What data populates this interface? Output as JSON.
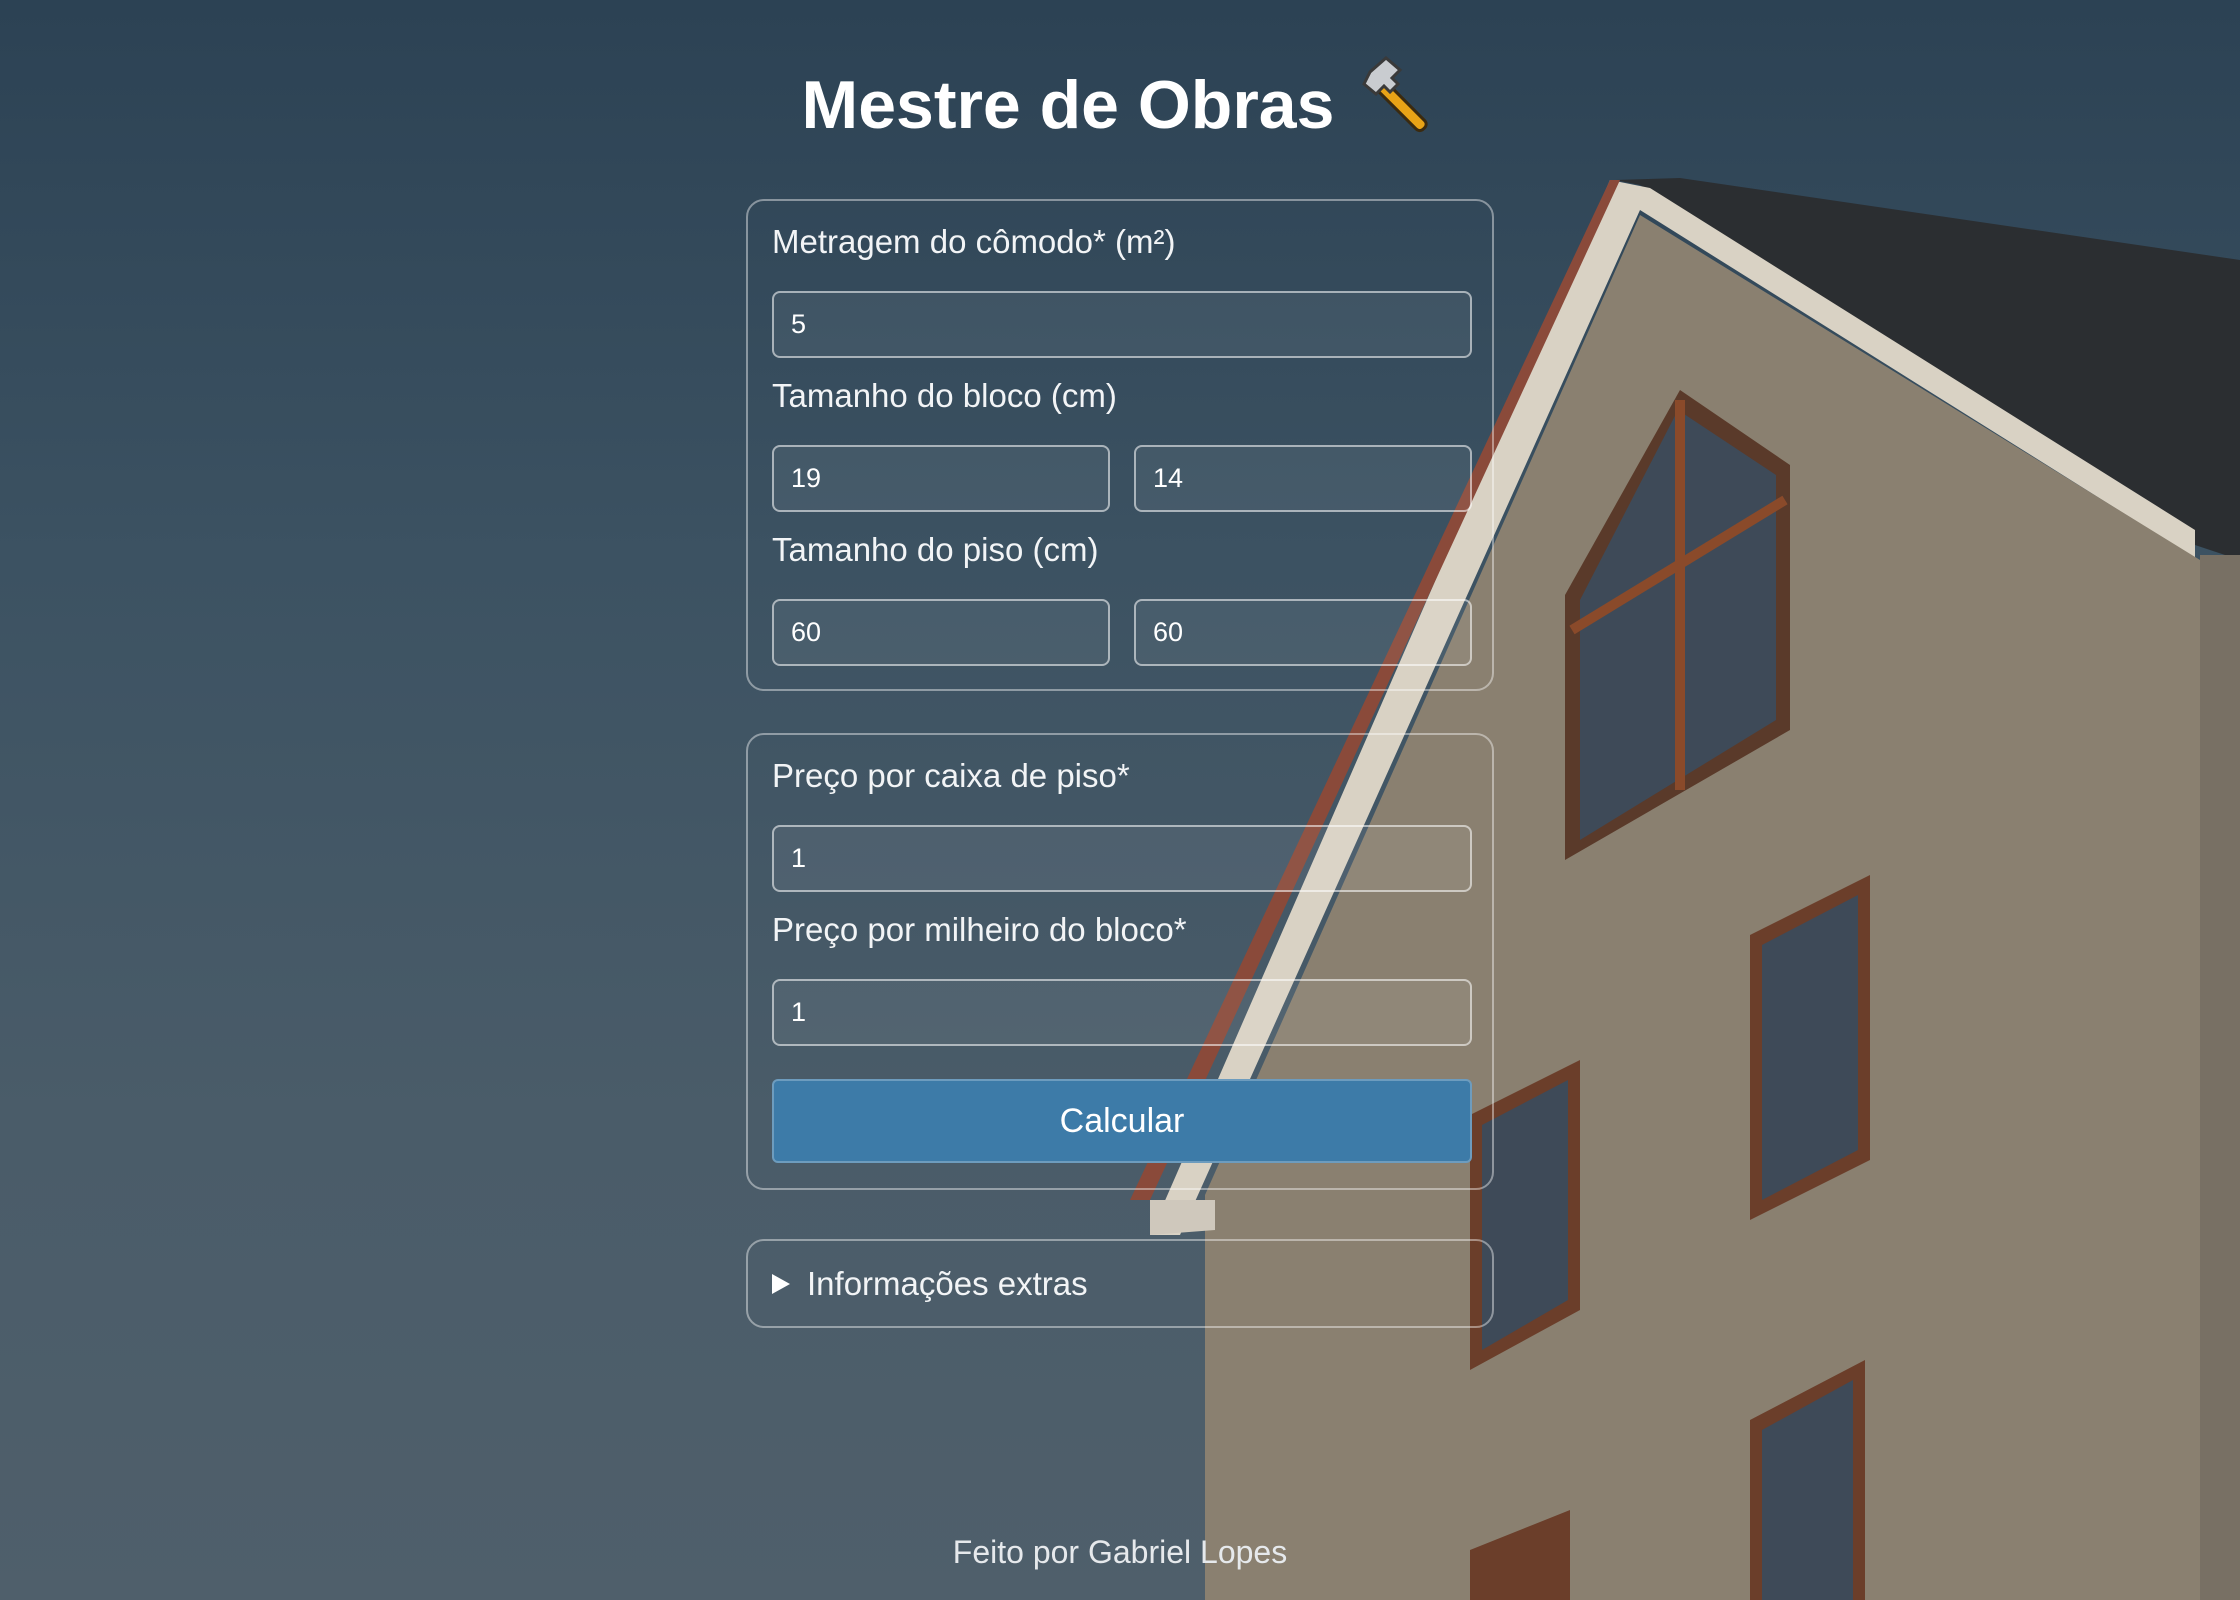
{
  "header": {
    "title": "Mestre de Obras",
    "icon": "hammer-icon"
  },
  "dimensions": {
    "area_label": "Metragem do cômodo* (m²)",
    "area_value": "5",
    "block_label": "Tamanho do bloco (cm)",
    "block_width": "19",
    "block_height": "14",
    "floor_label": "Tamanho do piso (cm)",
    "floor_width": "60",
    "floor_height": "60"
  },
  "prices": {
    "floor_box_label": "Preço por caixa de piso*",
    "floor_box_value": "1",
    "block_thousand_label": "Preço por milheiro do bloco*",
    "block_thousand_value": "1",
    "calculate_label": "Calcular"
  },
  "extras": {
    "summary_label": "Informações extras",
    "icon": "triangle-right-icon"
  },
  "footer": {
    "text": "Feito por Gabriel Lopes"
  },
  "colors": {
    "button": "#3d7ba8",
    "background_top": "#2c4254",
    "background_bottom": "#4f5f6b"
  }
}
